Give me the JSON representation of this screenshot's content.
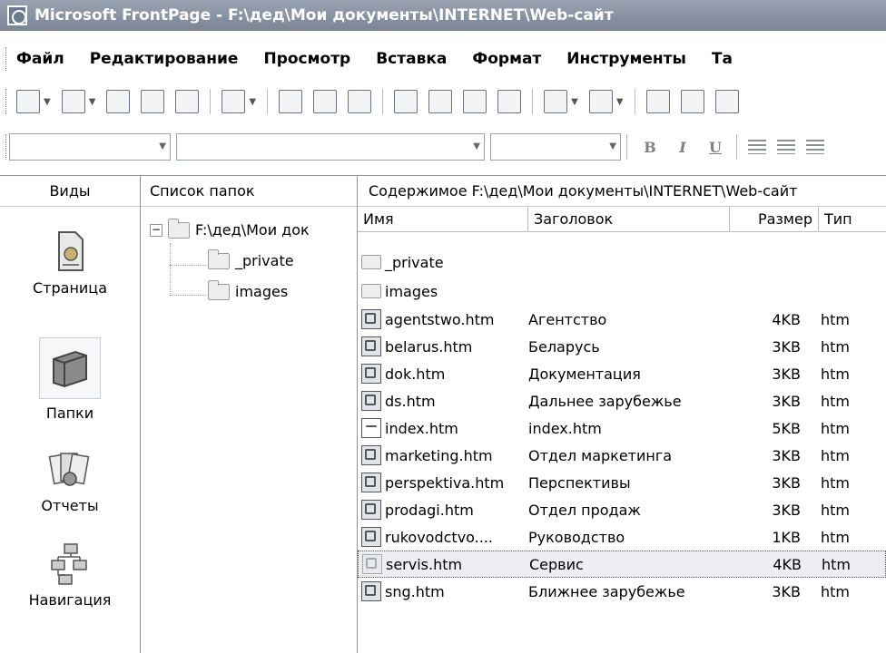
{
  "window": {
    "title": "Microsoft FrontPage - F:\\дед\\Мои документы\\INTERNET\\Web-сайт"
  },
  "menu": [
    "Файл",
    "Редактирование",
    "Просмотр",
    "Вставка",
    "Формат",
    "Инструменты",
    "Та"
  ],
  "format_toolbar": {
    "bold": "B",
    "italic": "I",
    "underline": "U"
  },
  "views_pane": {
    "header": "Виды",
    "items": [
      {
        "label": "Страница",
        "icon": "page-view-icon"
      },
      {
        "label": "Папки",
        "icon": "folders-view-icon"
      },
      {
        "label": "Отчеты",
        "icon": "reports-view-icon"
      },
      {
        "label": "Навигация",
        "icon": "navigation-view-icon"
      }
    ]
  },
  "folders_pane": {
    "header": "Список папок",
    "root": "F:\\дед\\Мои док",
    "children": [
      "_private",
      "images"
    ]
  },
  "contents_pane": {
    "header": "Содержимое F:\\дед\\Мои документы\\INTERNET\\Web-сайт",
    "columns": [
      "Имя",
      "Заголовок",
      "Размер",
      "Тип"
    ],
    "folders": [
      "_private",
      "images"
    ],
    "files": [
      {
        "name": "agentstwo.htm",
        "title": "Агентство",
        "size": "4KB",
        "type": "htm"
      },
      {
        "name": "belarus.htm",
        "title": "Беларусь",
        "size": "3KB",
        "type": "htm"
      },
      {
        "name": "dok.htm",
        "title": "Документация",
        "size": "3KB",
        "type": "htm"
      },
      {
        "name": "ds.htm",
        "title": "Дальнее зарубежье",
        "size": "3KB",
        "type": "htm"
      },
      {
        "name": "index.htm",
        "title": "index.htm",
        "size": "5KB",
        "type": "htm"
      },
      {
        "name": "marketing.htm",
        "title": "Отдел маркетинга",
        "size": "3KB",
        "type": "htm"
      },
      {
        "name": "perspektiva.htm",
        "title": "Перспективы",
        "size": "3KB",
        "type": "htm"
      },
      {
        "name": "prodagi.htm",
        "title": "Отдел продаж",
        "size": "3KB",
        "type": "htm"
      },
      {
        "name": "rukovodctvo....",
        "title": "Руководство",
        "size": "1KB",
        "type": "htm"
      },
      {
        "name": "servis.htm",
        "title": "Сервис",
        "size": "4KB",
        "type": "htm"
      },
      {
        "name": "sng.htm",
        "title": "Ближнее зарубежье",
        "size": "3KB",
        "type": "htm"
      }
    ]
  }
}
